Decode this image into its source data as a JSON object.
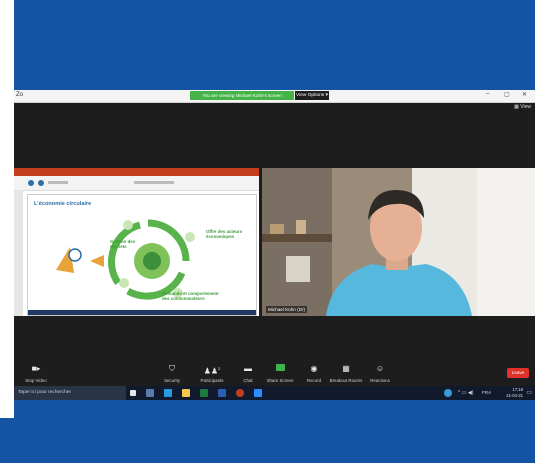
{
  "window": {
    "app_label": "Zo",
    "share_notice": "You are viewing Michael Kohn's screen",
    "view_options": "View Options",
    "view_button": "View",
    "controls": [
      "–",
      "▢",
      "✕"
    ]
  },
  "slide": {
    "title": "L'économie circulaire",
    "labels": [
      "Gestion des déchets",
      "Offre des acteurs économiques",
      "Demande et comportement des consommateurs"
    ]
  },
  "camera": {
    "participant_name": "Michael Kohn (Dr)"
  },
  "toolbar": {
    "items": [
      {
        "label": "Stop Video",
        "icon": "video-camera-icon"
      },
      {
        "label": "Security",
        "icon": "shield-icon"
      },
      {
        "label": "Participants",
        "icon": "participants-icon",
        "count": "2"
      },
      {
        "label": "Chat",
        "icon": "chat-icon"
      },
      {
        "label": "Share Screen",
        "icon": "share-screen-icon"
      },
      {
        "label": "Record",
        "icon": "record-icon"
      },
      {
        "label": "Breakout Rooms",
        "icon": "breakout-rooms-icon"
      },
      {
        "label": "Reactions",
        "icon": "reactions-icon"
      }
    ],
    "end_label": "Leave"
  },
  "taskbar": {
    "search_placeholder": "Taper ici pour rechercher",
    "language": "FRA",
    "time": "17:18",
    "date": "21-04-21"
  },
  "colors": {
    "banner": "#1454a4",
    "zoom_bg": "#1d1d1d",
    "share_green": "#44b348",
    "end_red": "#e0312b"
  }
}
